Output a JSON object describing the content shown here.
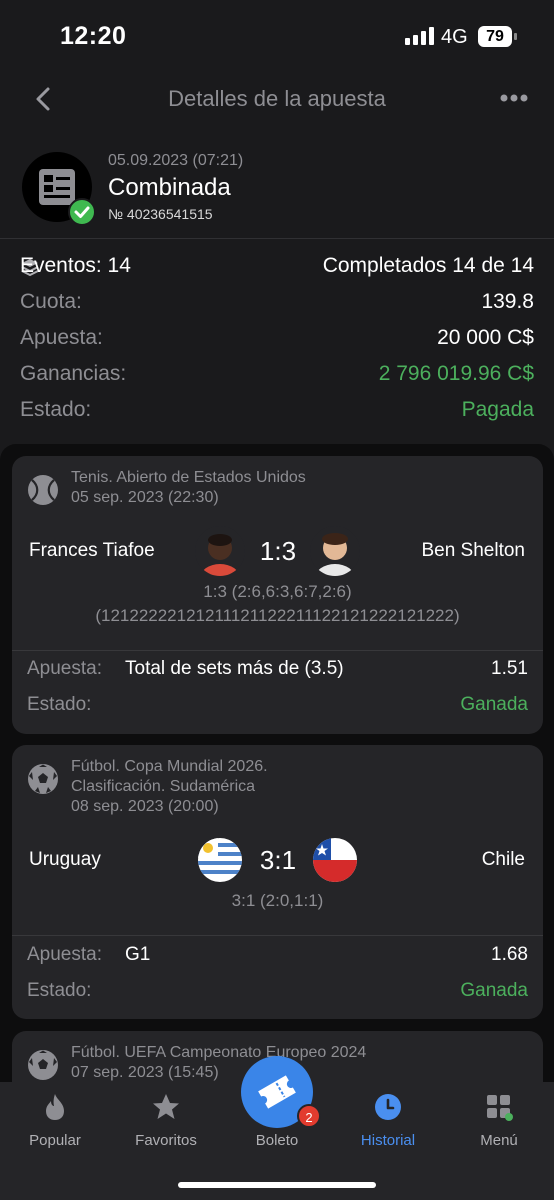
{
  "status_bar": {
    "time": "12:20",
    "network": "4G",
    "battery": "79"
  },
  "nav": {
    "title": "Detalles de la apuesta"
  },
  "bet": {
    "date": "05.09.2023 (07:21)",
    "type": "Combinada",
    "number": "№ 40236541515"
  },
  "summary": {
    "events_label": "Eventos: 14",
    "completed": "Completados 14 de 14",
    "odds_label": "Cuota:",
    "odds_value": "139.8",
    "stake_label": "Apuesta:",
    "stake_value": "20 000 C$",
    "winnings_label": "Ganancias:",
    "winnings_value": "2 796 019.96 C$",
    "status_label": "Estado:",
    "status_value": "Pagada"
  },
  "events": [
    {
      "sport_icon": "tennis-ball-icon",
      "meta_line1": "Tenis. Abierto de Estados Unidos",
      "meta_line2": "05 sep. 2023 (22:30)",
      "home": "Frances Tiafoe",
      "away": "Ben Shelton",
      "score": "1:3",
      "detail_line1": "1:3 (2:6,6:3,6:7,2:6)",
      "detail_line2": "(12122222121211121122211122121222121222)",
      "bet_label": "Apuesta:",
      "bet_value": "Total de sets más de (3.5)",
      "bet_odds": "1.51",
      "status_label": "Estado:",
      "status_value": "Ganada"
    },
    {
      "sport_icon": "soccer-ball-icon",
      "meta_line1": "Fútbol. Copa Mundial 2026.",
      "meta_line2": "Clasificación. Sudamérica",
      "meta_line3": "08 sep. 2023 (20:00)",
      "home": "Uruguay",
      "away": "Chile",
      "score": "3:1",
      "detail_line1": "3:1 (2:0,1:1)",
      "bet_label": "Apuesta:",
      "bet_value": "G1",
      "bet_odds": "1.68",
      "status_label": "Estado:",
      "status_value": "Ganada"
    },
    {
      "sport_icon": "soccer-ball-icon",
      "meta_line1": "Fútbol. UEFA Campeonato Europeo 2024",
      "meta_line2": "07 sep. 2023 (15:45)"
    }
  ],
  "tabs": [
    {
      "label": "Popular",
      "icon": "flame-icon"
    },
    {
      "label": "Favoritos",
      "icon": "star-icon"
    },
    {
      "label": "Boleto",
      "icon": "ticket-icon",
      "badge": "2"
    },
    {
      "label": "Historial",
      "icon": "clock-icon",
      "active": true
    },
    {
      "label": "Menú",
      "icon": "grid-icon"
    }
  ],
  "colors": {
    "accent": "#3a85e8",
    "success": "#4cb05d",
    "background": "#1a1a1c",
    "card": "#252528"
  }
}
